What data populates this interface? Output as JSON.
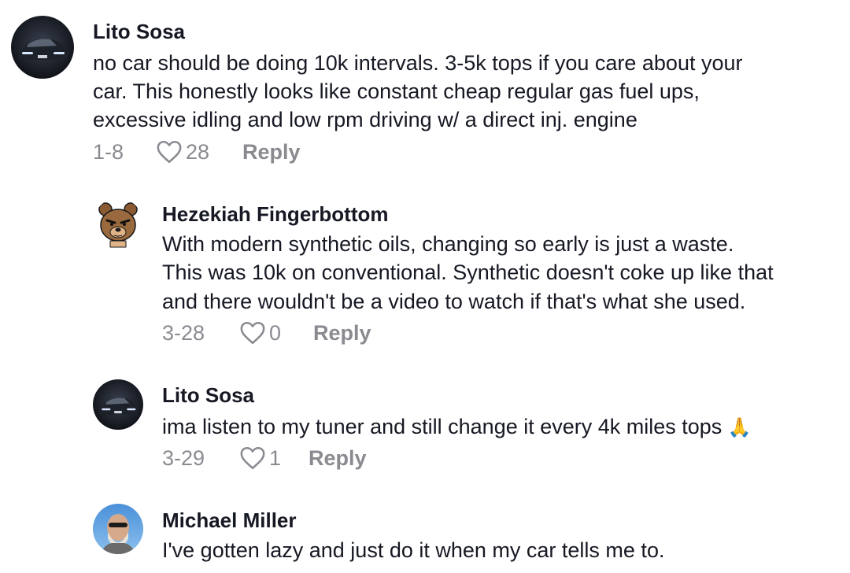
{
  "comments": [
    {
      "author": "Lito Sosa",
      "lines": [
        "no car should be doing 10k intervals. 3-5k tops if you care about your",
        "car. This honestly looks like constant cheap regular gas fuel ups,",
        "excessive idling and low rpm driving w/ a direct inj. engine"
      ],
      "date": "1-8",
      "likes": "28",
      "reply_label": "Reply",
      "avatar_icon": "car-photo-avatar"
    },
    {
      "author": "Hezekiah Fingerbottom",
      "lines": [
        "With modern synthetic oils, changing so early is just a waste.",
        "This was 10k on conventional. Synthetic doesn't coke up like that",
        "and there wouldn't be a video to watch if that's what she used."
      ],
      "date": "3-28",
      "likes": "0",
      "reply_label": "Reply",
      "avatar_icon": "cartoon-bear-avatar"
    },
    {
      "author": "Lito Sosa",
      "lines": [
        "ima listen to my tuner and still change it every 4k miles tops"
      ],
      "emoji": "🙏",
      "date": "3-29",
      "likes": "1",
      "reply_label": "Reply",
      "avatar_icon": "car-photo-avatar"
    },
    {
      "author": "Michael Miller",
      "lines": [
        "I've gotten lazy and just do it when my car tells me to."
      ],
      "avatar_icon": "man-sunglasses-photo-avatar"
    }
  ],
  "colors": {
    "text": "#161823",
    "muted": "#8a8b91",
    "background": "#ffffff"
  }
}
